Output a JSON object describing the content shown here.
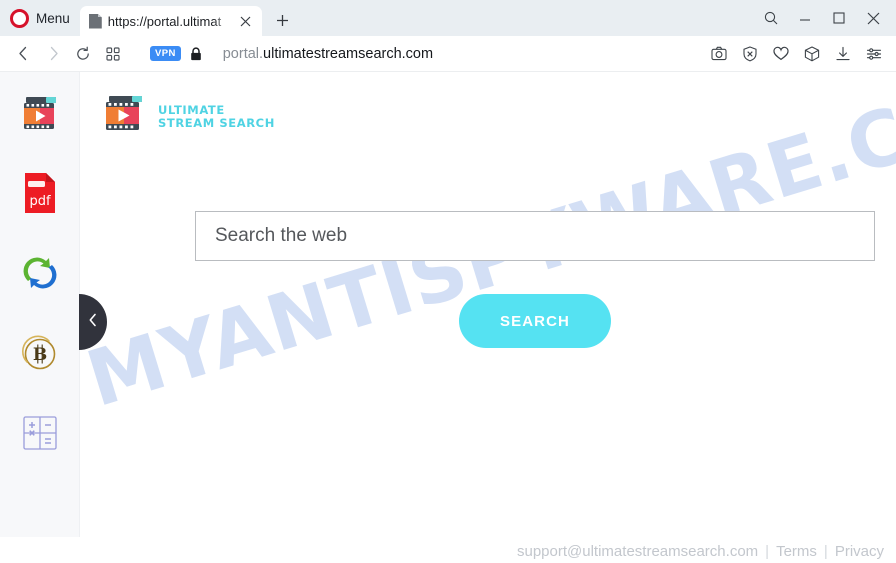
{
  "browser": {
    "name": "Opera",
    "menu_label": "Menu",
    "tab": {
      "title": "https://portal.ultimat",
      "favicon": "page-icon",
      "close_icon": "close-icon"
    },
    "new_tab_icon": "plus-icon",
    "window_controls": [
      {
        "name": "tab-search-icon",
        "glyph": "search"
      },
      {
        "name": "minimize-icon",
        "glyph": "minimize"
      },
      {
        "name": "maximize-icon",
        "glyph": "maximize"
      },
      {
        "name": "close-window-icon",
        "glyph": "close"
      }
    ],
    "nav": {
      "back_icon": "back-icon",
      "forward_icon": "forward-icon",
      "reload_icon": "reload-icon",
      "tab_overview_icon": "grid-icon"
    },
    "address": {
      "vpn_badge": "VPN",
      "lock_icon": "lock-icon",
      "url_prefix": "portal.",
      "url_domain": "ultimatestreamsearch.com"
    },
    "toolbar_icons": [
      {
        "name": "snapshot-icon"
      },
      {
        "name": "adblock-shield-icon"
      },
      {
        "name": "heart-icon"
      },
      {
        "name": "crypto-wallet-icon"
      },
      {
        "name": "downloads-icon"
      },
      {
        "name": "easy-setup-icon"
      }
    ]
  },
  "sidebar": {
    "items": [
      {
        "name": "video-downloader-icon",
        "label": "Video Player"
      },
      {
        "name": "pdf-converter-icon",
        "label": "pdf"
      },
      {
        "name": "file-converter-icon",
        "label": "Converter"
      },
      {
        "name": "bitcoin-icon",
        "label": "Bitcoin"
      },
      {
        "name": "calculator-icon",
        "label": "Calculator"
      }
    ],
    "collapse_icon": "chevron-left-icon"
  },
  "site": {
    "brand": {
      "line1": "ULTIMATE",
      "line2": "STREAM SEARCH",
      "logo_icon": "film-play-icon",
      "color": "#4fd3e3"
    },
    "search": {
      "placeholder": "Search the web",
      "value": "",
      "button_label": "SEARCH",
      "button_color": "#55e2f2"
    },
    "footer": {
      "email": "support@ultimatestreamsearch.com",
      "separator": "|",
      "terms": "Terms",
      "privacy": "Privacy"
    }
  },
  "watermark": {
    "text": "MYANTISPYWARE.COM",
    "color": "#c3d4f2"
  }
}
